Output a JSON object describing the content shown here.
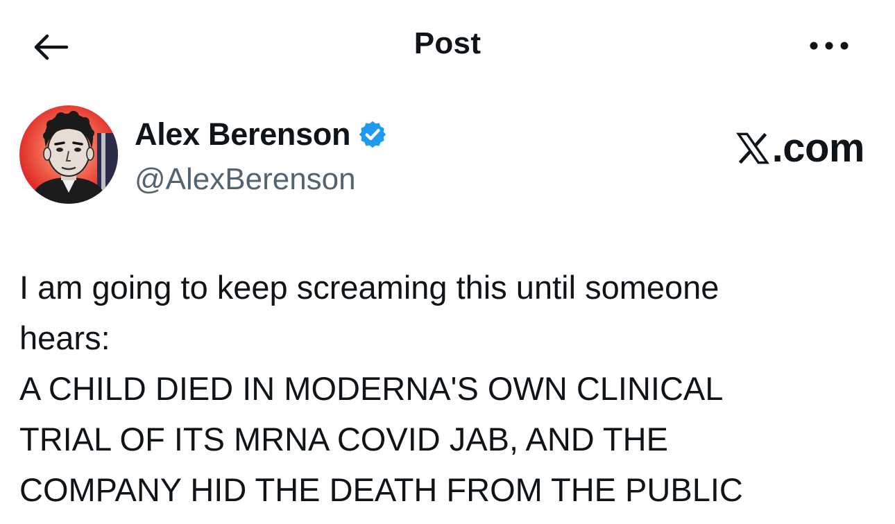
{
  "header": {
    "title": "Post",
    "back_icon": "arrow-left-icon",
    "more_icon": "more-horizontal-icon"
  },
  "author": {
    "display_name": "Alex Berenson",
    "handle": "@AlexBerenson",
    "verified": true,
    "verified_color": "#1d9bf0",
    "avatar_accent": "#e8262a"
  },
  "watermark": {
    "logo_icon": "x-logo-icon",
    "text": ".com"
  },
  "post": {
    "lines": [
      "I am going to keep screaming this until someone",
      "hears:",
      "A CHILD DIED IN MODERNA'S OWN CLINICAL",
      "TRIAL OF ITS MRNA COVID JAB, AND THE",
      "COMPANY HID THE DEATH FROM THE PUBLIC"
    ]
  },
  "colors": {
    "text_primary": "#0f1419",
    "text_secondary": "#536471",
    "background": "#ffffff"
  }
}
